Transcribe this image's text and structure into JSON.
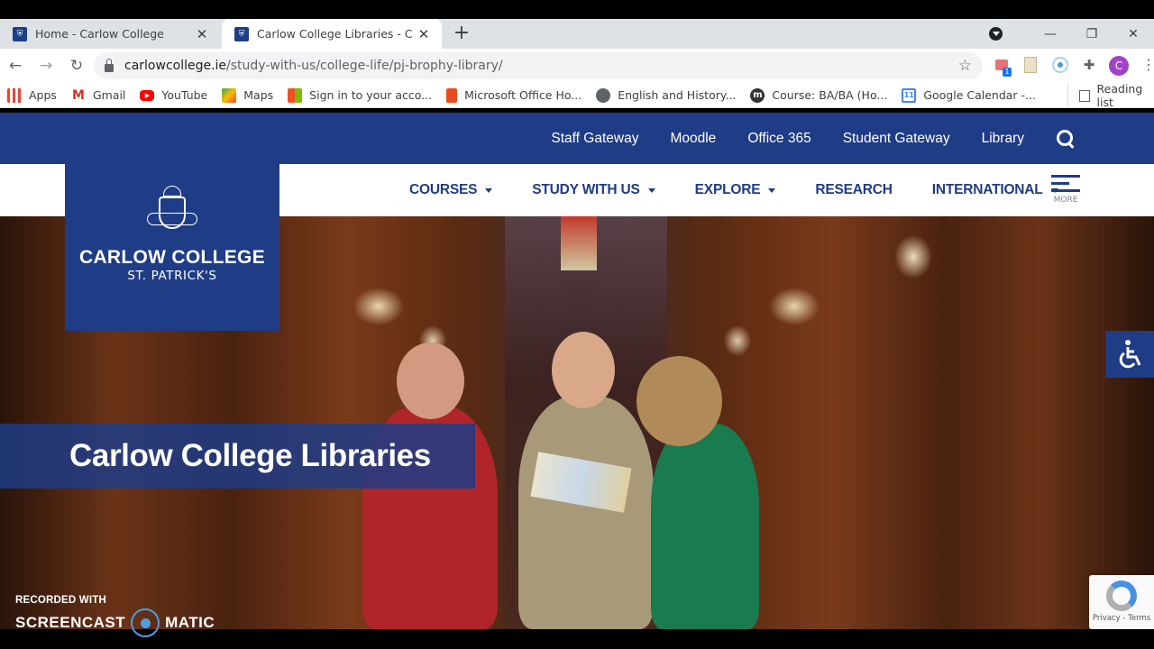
{
  "browser": {
    "tabs": [
      {
        "title": "Home - Carlow College",
        "active": false
      },
      {
        "title": "Carlow College Libraries - Carlow",
        "active": true
      }
    ],
    "new_tab_label": "+",
    "url_domain": "carlowcollege.ie",
    "url_path": "/study-with-us/college-life/pj-brophy-library/",
    "profile_initial": "C",
    "extension_badge": "1",
    "bookmarks": [
      {
        "label": "Apps",
        "icon": "apps-grid-icon"
      },
      {
        "label": "Gmail",
        "icon": "gmail-icon"
      },
      {
        "label": "YouTube",
        "icon": "youtube-icon"
      },
      {
        "label": "Maps",
        "icon": "maps-icon"
      },
      {
        "label": "Sign in to your acco...",
        "icon": "microsoft-icon"
      },
      {
        "label": "Microsoft Office Ho...",
        "icon": "office-icon"
      },
      {
        "label": "English and History...",
        "icon": "globe-icon"
      },
      {
        "label": "Course: BA/BA (Ho...",
        "icon": "moodle-icon"
      },
      {
        "label": "Google Calendar -...",
        "icon": "calendar-icon"
      }
    ],
    "calendar_day": "11",
    "reading_list": "Reading list"
  },
  "site": {
    "utility_links": [
      "Staff Gateway",
      "Moodle",
      "Office 365",
      "Student Gateway",
      "Library"
    ],
    "main_nav": [
      {
        "label": "COURSES",
        "dropdown": true
      },
      {
        "label": "STUDY WITH US",
        "dropdown": true
      },
      {
        "label": "EXPLORE",
        "dropdown": true
      },
      {
        "label": "RESEARCH",
        "dropdown": false
      },
      {
        "label": "INTERNATIONAL",
        "dropdown": true
      }
    ],
    "more_label": "MORE",
    "logo": {
      "name": "CARLOW COLLEGE",
      "sub": "ST. PATRICK'S"
    },
    "hero_title": "Carlow College Libraries",
    "recaptcha_links": "Privacy - Terms",
    "brand_color": "#1f3c86"
  },
  "watermark": {
    "recorded_with": "RECORDED WITH",
    "left": "SCREENCAST",
    "right": "MATIC"
  }
}
